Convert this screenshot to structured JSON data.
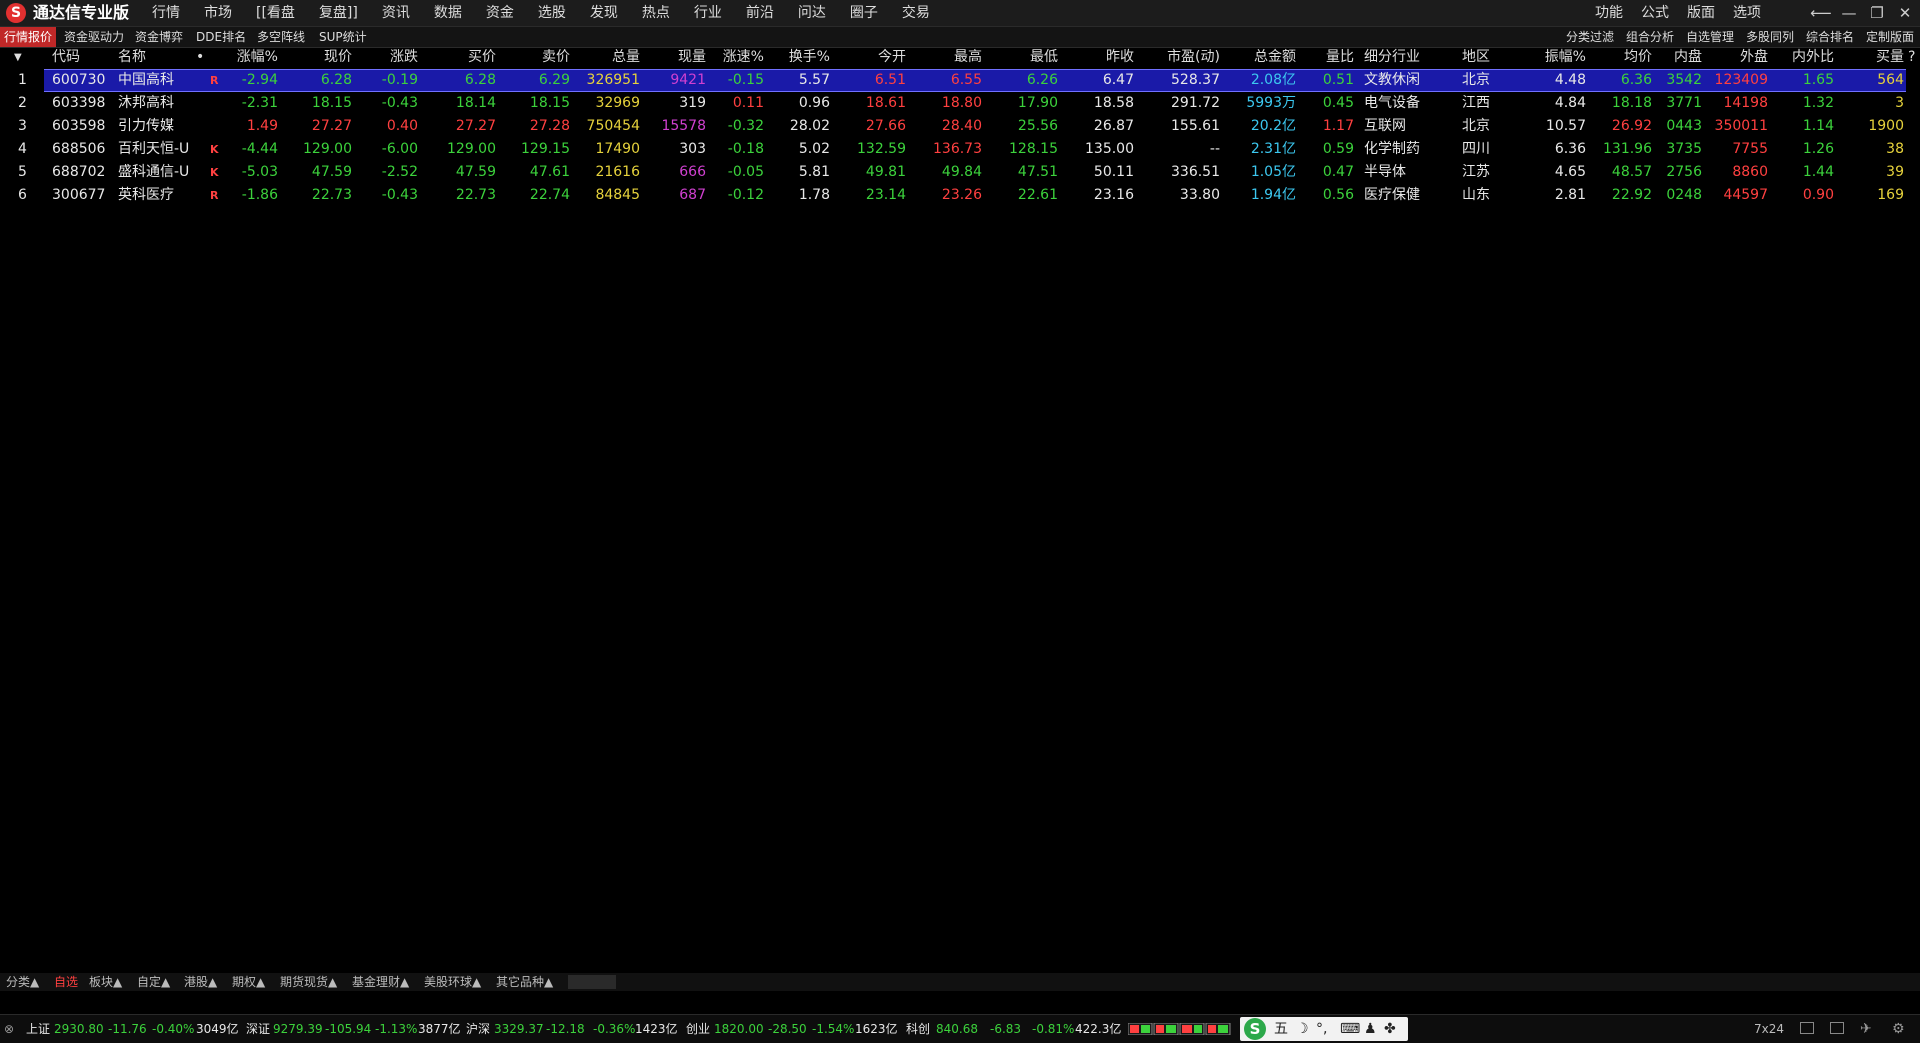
{
  "app": {
    "title": "通达信专业版",
    "logo_glyph": "S"
  },
  "menu": [
    "行情",
    "市场",
    "[[看盘",
    "复盘]]",
    "资讯",
    "数据",
    "资金",
    "选股",
    "发现",
    "热点",
    "行业",
    "前沿",
    "问达",
    "圈子",
    "交易"
  ],
  "menu_right": [
    "功能",
    "公式",
    "版面",
    "选项"
  ],
  "window_controls": {
    "back": "⟵",
    "minimize": "—",
    "restore": "❐",
    "close": "✕"
  },
  "subtabs": [
    "行情报价",
    "资金驱动力",
    "资金博弈",
    "DDE排名",
    "多空阵线",
    "SUP统计"
  ],
  "subtabs_right": [
    "分类过滤",
    "组合分析",
    "自选管理",
    "多股同列",
    "综合排名",
    "定制版面"
  ],
  "columns": {
    "sort_arrow": "▼",
    "code": "代码",
    "name": "名称",
    "dot": "•",
    "pct": "涨幅%",
    "price": "现价",
    "change": "涨跌",
    "bid": "买价",
    "ask": "卖价",
    "volume": "总量",
    "cur_vol": "现量",
    "speed": "涨速%",
    "turnover": "换手%",
    "open": "今开",
    "high": "最高",
    "low": "最低",
    "prev_close": "昨收",
    "pe": "市盈(动)",
    "amount": "总金额",
    "vol_ratio": "量比",
    "industry": "细分行业",
    "region": "地区",
    "amplitude": "振幅%",
    "avg_price": "均价",
    "inner": "内盘",
    "outer": "外盘",
    "in_out_ratio": "内外比",
    "buy_vol": "买量",
    "help": "?"
  },
  "rows": [
    {
      "idx": "1",
      "code": "600730",
      "name": "中国高科",
      "flag": "R",
      "pct": "-2.94",
      "price": "6.28",
      "change": "-0.19",
      "bid": "6.28",
      "ask": "6.29",
      "volume": "326951",
      "cur_vol": "9421",
      "speed": "-0.15",
      "turnover": "5.57",
      "open": "6.51",
      "high": "6.55",
      "low": "6.26",
      "prev_close": "6.47",
      "pe": "528.37",
      "amount": "2.08亿",
      "vol_ratio": "0.51",
      "industry": "文教休闲",
      "region": "北京",
      "amplitude": "4.48",
      "avg_price": "6.36",
      "inner": "3542",
      "outer": "123409",
      "in_out_ratio": "1.65",
      "buy_vol": "564"
    },
    {
      "idx": "2",
      "code": "603398",
      "name": "沐邦高科",
      "flag": "",
      "pct": "-2.31",
      "price": "18.15",
      "change": "-0.43",
      "bid": "18.14",
      "ask": "18.15",
      "volume": "32969",
      "cur_vol": "319",
      "speed": "0.11",
      "turnover": "0.96",
      "open": "18.61",
      "high": "18.80",
      "low": "17.90",
      "prev_close": "18.58",
      "pe": "291.72",
      "amount": "5993万",
      "vol_ratio": "0.45",
      "industry": "电气设备",
      "region": "江西",
      "amplitude": "4.84",
      "avg_price": "18.18",
      "inner": "3771",
      "outer": "14198",
      "in_out_ratio": "1.32",
      "buy_vol": "3"
    },
    {
      "idx": "3",
      "code": "603598",
      "name": "引力传媒",
      "flag": "",
      "pct": "1.49",
      "price": "27.27",
      "change": "0.40",
      "bid": "27.27",
      "ask": "27.28",
      "volume": "750454",
      "cur_vol": "15578",
      "speed": "-0.32",
      "turnover": "28.02",
      "open": "27.66",
      "high": "28.40",
      "low": "25.56",
      "prev_close": "26.87",
      "pe": "155.61",
      "amount": "20.2亿",
      "vol_ratio": "1.17",
      "industry": "互联网",
      "region": "北京",
      "amplitude": "10.57",
      "avg_price": "26.92",
      "inner": "0443",
      "outer": "350011",
      "in_out_ratio": "1.14",
      "buy_vol": "1900"
    },
    {
      "idx": "4",
      "code": "688506",
      "name": "百利天恒-U",
      "flag": "K",
      "pct": "-4.44",
      "price": "129.00",
      "change": "-6.00",
      "bid": "129.00",
      "ask": "129.15",
      "volume": "17490",
      "cur_vol": "303",
      "speed": "-0.18",
      "turnover": "5.02",
      "open": "132.59",
      "high": "136.73",
      "low": "128.15",
      "prev_close": "135.00",
      "pe": "--",
      "amount": "2.31亿",
      "vol_ratio": "0.59",
      "industry": "化学制药",
      "region": "四川",
      "amplitude": "6.36",
      "avg_price": "131.96",
      "inner": "3735",
      "outer": "7755",
      "in_out_ratio": "1.26",
      "buy_vol": "38"
    },
    {
      "idx": "5",
      "code": "688702",
      "name": "盛科通信-U",
      "flag": "K",
      "pct": "-5.03",
      "price": "47.59",
      "change": "-2.52",
      "bid": "47.59",
      "ask": "47.61",
      "volume": "21616",
      "cur_vol": "666",
      "speed": "-0.05",
      "turnover": "5.81",
      "open": "49.81",
      "high": "49.84",
      "low": "47.51",
      "prev_close": "50.11",
      "pe": "336.51",
      "amount": "1.05亿",
      "vol_ratio": "0.47",
      "industry": "半导体",
      "region": "江苏",
      "amplitude": "4.65",
      "avg_price": "48.57",
      "inner": "2756",
      "outer": "8860",
      "in_out_ratio": "1.44",
      "buy_vol": "39"
    },
    {
      "idx": "6",
      "code": "300677",
      "name": "英科医疗",
      "flag": "R",
      "pct": "-1.86",
      "price": "22.73",
      "change": "-0.43",
      "bid": "22.73",
      "ask": "22.74",
      "volume": "84845",
      "cur_vol": "687",
      "speed": "-0.12",
      "turnover": "1.78",
      "open": "23.14",
      "high": "23.26",
      "low": "22.61",
      "prev_close": "23.16",
      "pe": "33.80",
      "amount": "1.94亿",
      "vol_ratio": "0.56",
      "industry": "医疗保健",
      "region": "山东",
      "amplitude": "2.81",
      "avg_price": "22.92",
      "inner": "0248",
      "outer": "44597",
      "in_out_ratio": "0.90",
      "buy_vol": "169"
    }
  ],
  "bottom_tabs": [
    "分类▲",
    "自选",
    "板块▲",
    "自定▲",
    "港股▲",
    "期权▲",
    "期货现货▲",
    "基金理财▲",
    "美股环球▲",
    "其它品种▲"
  ],
  "status": {
    "sh": {
      "label": "上证",
      "value": "2930.80",
      "change": "-11.76",
      "pct": "-0.40%",
      "amount": "3049亿"
    },
    "sz": {
      "label": "深证",
      "value": "9279.39",
      "change": "-105.94",
      "pct": "-1.13%",
      "amount": "3877亿"
    },
    "hs": {
      "label": "沪深",
      "value": "3329.37",
      "change": "-12.18",
      "pct": "-0.36%",
      "amount": "1423亿"
    },
    "cy": {
      "label": "创业",
      "value": "1820.00",
      "change": "-28.50",
      "pct": "-1.54%",
      "amount": "1623亿"
    },
    "kc": {
      "label": "科创",
      "value": "840.68",
      "change": "-6.83",
      "pct": "-0.81%",
      "amount": "422.3亿"
    },
    "ime": {
      "logo": "S",
      "mode": "五",
      "moon": "☽",
      "punct": "°,",
      "keyboard": "⌨",
      "user": "♟",
      "grid": "✤"
    },
    "trade_time": "7x24"
  }
}
